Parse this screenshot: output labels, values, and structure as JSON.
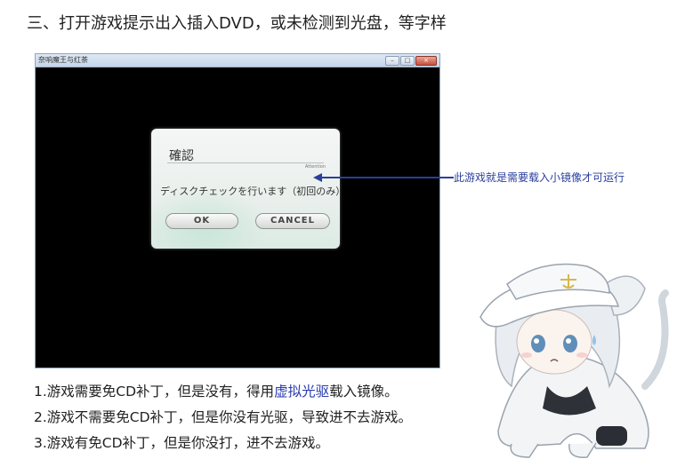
{
  "heading": "三、打开游戏提示出入插入DVD，或未检测到光盘，等字样",
  "window": {
    "title": "奈响魔王与红茶",
    "buttons": [
      "–",
      "□",
      "×"
    ]
  },
  "dialog": {
    "title": "確認",
    "subtitle": "Attention",
    "message": "ディスクチェックを行います（初回のみ）",
    "ok": "OK",
    "cancel": "CANCEL"
  },
  "annotation": "此游戏就是需要载入小镜像才可运行",
  "colors": {
    "accent": "#2a3f9e",
    "link": "#2a3cb0"
  },
  "lines": [
    {
      "before": "1.游戏需要免CD补丁，但是没有，得用",
      "link": "虚拟光驱",
      "after": "载入镜像。"
    },
    {
      "text": "2.游戏不需要免CD补丁，但是你没有光驱，导致进不去游戏。"
    },
    {
      "text": "3.游戏有免CD补丁，但是你没打，进不去游戏。"
    }
  ],
  "mascot_icon": "anime-cat-girl-with-white-cap"
}
